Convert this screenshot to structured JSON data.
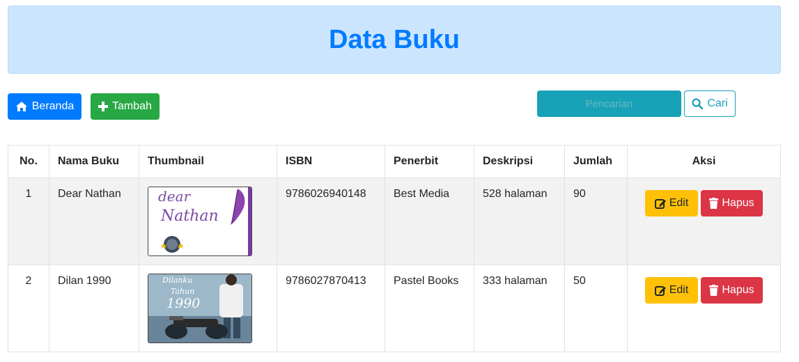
{
  "header": {
    "title": "Data Buku"
  },
  "toolbar": {
    "home_label": "Beranda",
    "add_label": "Tambah",
    "search_placeholder": "Pencarian",
    "search_label": "Cari"
  },
  "colors": {
    "primary": "#007bff",
    "success": "#28a745",
    "info": "#17a2b8",
    "warning": "#ffc107",
    "danger": "#dc3545",
    "header_bg": "#cce5ff"
  },
  "table": {
    "headers": [
      "No.",
      "Nama Buku",
      "Thumbnail",
      "ISBN",
      "Penerbit",
      "Deskripsi",
      "Jumlah",
      "Aksi"
    ],
    "rows": [
      {
        "no": "1",
        "nama": "Dear Nathan",
        "thumb_text": [
          "dear",
          "Nathan"
        ],
        "isbn": "9786026940148",
        "penerbit": "Best Media",
        "deskripsi": "528 halaman",
        "jumlah": "90",
        "edit": "Edit",
        "hapus": "Hapus"
      },
      {
        "no": "2",
        "nama": "Dilan 1990",
        "thumb_text": [
          "Dilanku",
          "Tahun",
          "1990"
        ],
        "isbn": "9786027870413",
        "penerbit": "Pastel Books",
        "deskripsi": "333 halaman",
        "jumlah": "50",
        "edit": "Edit",
        "hapus": "Hapus"
      }
    ]
  },
  "icons": {
    "home": "home-icon",
    "add": "plus-icon",
    "search": "search-icon",
    "edit": "edit-icon",
    "delete": "trash-icon"
  }
}
